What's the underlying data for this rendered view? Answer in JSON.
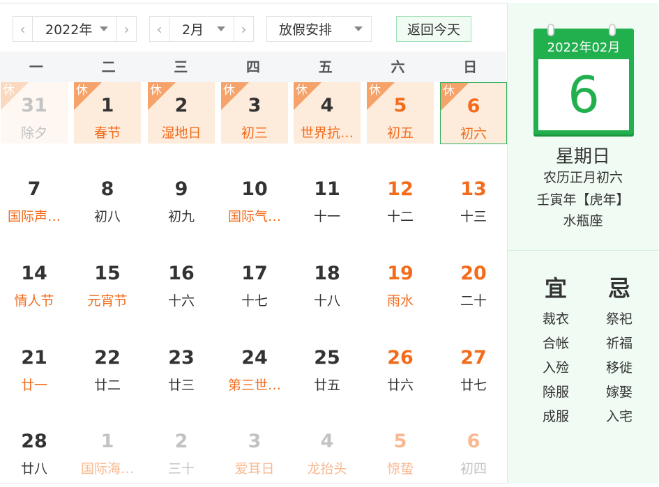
{
  "toolbar": {
    "year": "2022年",
    "month": "2月",
    "holiday": "放假安排",
    "today": "返回今天",
    "prev": "‹",
    "next": "›"
  },
  "weekdays": [
    "一",
    "二",
    "三",
    "四",
    "五",
    "六",
    "日"
  ],
  "rest_label": "休",
  "days": [
    {
      "num": "31",
      "sub": "除夕",
      "rest": true,
      "faded": true
    },
    {
      "num": "1",
      "sub": "春节",
      "rest": true,
      "sub_red": true
    },
    {
      "num": "2",
      "sub": "湿地日",
      "rest": true,
      "sub_red": true
    },
    {
      "num": "3",
      "sub": "初三",
      "rest": true,
      "sub_red": true
    },
    {
      "num": "4",
      "sub": "世界抗…",
      "rest": true,
      "sub_red": true
    },
    {
      "num": "5",
      "sub": "初五",
      "rest": true,
      "num_red": true,
      "sub_red": true
    },
    {
      "num": "6",
      "sub": "初六",
      "rest": true,
      "num_red": true,
      "sub_red": true,
      "selected": true
    },
    {
      "num": "7",
      "sub": "国际声…",
      "sub_red": true
    },
    {
      "num": "8",
      "sub": "初八"
    },
    {
      "num": "9",
      "sub": "初九"
    },
    {
      "num": "10",
      "sub": "国际气…",
      "sub_red": true
    },
    {
      "num": "11",
      "sub": "十一"
    },
    {
      "num": "12",
      "sub": "十二",
      "num_red": true
    },
    {
      "num": "13",
      "sub": "十三",
      "num_red": true
    },
    {
      "num": "14",
      "sub": "情人节",
      "sub_red": true
    },
    {
      "num": "15",
      "sub": "元宵节",
      "sub_red": true
    },
    {
      "num": "16",
      "sub": "十六"
    },
    {
      "num": "17",
      "sub": "十七"
    },
    {
      "num": "18",
      "sub": "十八"
    },
    {
      "num": "19",
      "sub": "雨水",
      "num_red": true,
      "sub_red": true
    },
    {
      "num": "20",
      "sub": "二十",
      "num_red": true
    },
    {
      "num": "21",
      "sub": "廿一",
      "sub_red": true
    },
    {
      "num": "22",
      "sub": "廿二"
    },
    {
      "num": "23",
      "sub": "廿三"
    },
    {
      "num": "24",
      "sub": "第三世…",
      "sub_red": true
    },
    {
      "num": "25",
      "sub": "廿五"
    },
    {
      "num": "26",
      "sub": "廿六",
      "num_red": true
    },
    {
      "num": "27",
      "sub": "廿七",
      "num_red": true
    },
    {
      "num": "28",
      "sub": "廿八"
    },
    {
      "num": "1",
      "sub": "国际海…",
      "faded": true,
      "sub_red": true
    },
    {
      "num": "2",
      "sub": "三十",
      "faded": true
    },
    {
      "num": "3",
      "sub": "爱耳日",
      "faded": true,
      "sub_red": true
    },
    {
      "num": "4",
      "sub": "龙抬头",
      "faded": true,
      "sub_red": true
    },
    {
      "num": "5",
      "sub": "惊蛰",
      "faded": true,
      "num_red": true,
      "sub_red": true
    },
    {
      "num": "6",
      "sub": "初四",
      "faded": true,
      "num_red": true
    }
  ],
  "side": {
    "year_month": "2022年02月",
    "day": "6",
    "weekday": "星期日",
    "lunar": "农历正月初六",
    "ganzhi": "壬寅年【虎年】",
    "constellation": "水瓶座",
    "yi_title": "宜",
    "ji_title": "忌",
    "yi": [
      "裁衣",
      "合帐",
      "入殓",
      "除服",
      "成服"
    ],
    "ji": [
      "祭祀",
      "祈福",
      "移徙",
      "嫁娶",
      "入宅"
    ]
  },
  "colors": {
    "accent_green": "#22b04e",
    "holiday_red": "#f26c1c",
    "rest_bg": "#fdebdc",
    "rest_tag": "#f5a36b"
  }
}
